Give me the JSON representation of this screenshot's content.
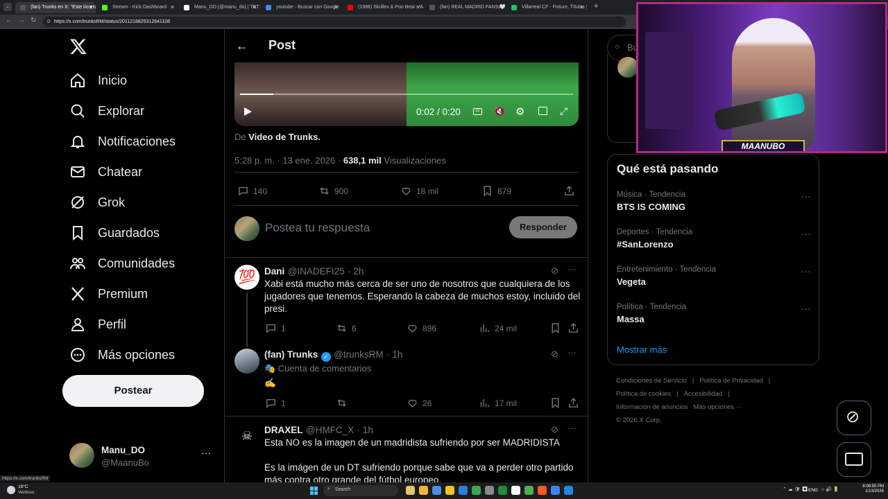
{
  "browser": {
    "tabs": [
      {
        "label": "(fan) Trunks en X: \"Este tío era...",
        "color": "#555"
      },
      {
        "label": "Stream - Kick Dashboard",
        "color": "#53fc18"
      },
      {
        "label": "Manu_DO (@manu_do) | TikT...",
        "color": "#fff"
      },
      {
        "label": "youtube - Buscar con Google",
        "color": "#4285f4"
      },
      {
        "label": "(1988) Skrillex & Poo Bear - Wh...",
        "color": "#ff0000"
      },
      {
        "label": "(fan) REAL MADRID FANS 🤍 | ...",
        "color": "#555"
      },
      {
        "label": "Villarreal CF - Fixture, Títulos y...",
        "color": "#22c55e"
      }
    ],
    "url": "https://x.com/trunksRM/status/2011218825312641108",
    "status_url": "https://x.com/trunksRM"
  },
  "nav": {
    "items": [
      {
        "label": "Inicio",
        "icon": "home-icon"
      },
      {
        "label": "Explorar",
        "icon": "search-icon"
      },
      {
        "label": "Notificaciones",
        "icon": "bell-icon"
      },
      {
        "label": "Chatear",
        "icon": "mail-icon"
      },
      {
        "label": "Grok",
        "icon": "grok-icon"
      },
      {
        "label": "Guardados",
        "icon": "bookmark-icon"
      },
      {
        "label": "Comunidades",
        "icon": "communities-icon"
      },
      {
        "label": "Premium",
        "icon": "x-logo-icon"
      },
      {
        "label": "Perfil",
        "icon": "person-icon"
      },
      {
        "label": "Más opciones",
        "icon": "more-circle-icon"
      }
    ],
    "post_button": "Postear",
    "account": {
      "name": "Manu_DO",
      "handle": "@MaanuBo"
    }
  },
  "post": {
    "header": "Post",
    "video": {
      "time": "0:02 / 0:20",
      "progress": 0.1
    },
    "from_prefix": "De",
    "from_source": "Video de Trunks.",
    "timestamp": "5:28 p. m. · 13 ene. 2026 ·",
    "views": "638,1 mil",
    "views_label": "Visualizaciones",
    "stats": {
      "replies": "140",
      "reposts": "900",
      "likes": "18 mil",
      "bookmarks": "879"
    },
    "reply_placeholder": "Postea tu respuesta",
    "reply_button": "Responder"
  },
  "replies": [
    {
      "name": "Dani",
      "handle": "@INADEFI25",
      "time": "· 2h",
      "text": "Xabi está mucho más cerca de ser uno de nosotros que cualquiera de los jugadores que tenemos. Esperando la cabeza de muchos estoy, incluido del presi.",
      "replies": "1",
      "reposts": "6",
      "likes": "896",
      "views": "24 mil",
      "avatar_glyph": "💯"
    },
    {
      "name": "(fan) Trunks",
      "handle": "@trunksRM",
      "time": "· 1h",
      "tag": "🎭 Cuenta de comentarios",
      "text": "✍️",
      "replies": "1",
      "reposts": "",
      "likes": "26",
      "views": "17 mil"
    },
    {
      "name": "DRAXEL",
      "handle": "@HMFC_X",
      "time": "· 1h",
      "text1": "Esta NO es la imagen de un madridista sufriendo por ser MADRIDISTA",
      "text2": "Es la imágen de un DT sufriendo porque sabe que va a perder otro partido más contra otro grande del fútbol europeo."
    }
  ],
  "sidebar": {
    "search_placeholder": "Bu",
    "trends_title": "Qué está pasando",
    "trends": [
      {
        "category": "Música · Tendencia",
        "title": "BTS IS COMING"
      },
      {
        "category": "Deportes · Tendencia",
        "title": "#SanLorenzo"
      },
      {
        "category": "Entretenimiento · Tendencia",
        "title": "Vegeta"
      },
      {
        "category": "Política · Tendencia",
        "title": "Massa"
      }
    ],
    "show_more": "Mostrar más",
    "footer": [
      "Condiciones de Servicio",
      "|",
      "Política de Privacidad",
      "|",
      "Política de cookies",
      "|",
      "Accesibilidad",
      "|",
      "Información de anuncios",
      "Más opciones ···",
      "© 2026 X Corp."
    ]
  },
  "overlay": {
    "streamer_name": "MAANUBO"
  },
  "taskbar": {
    "weather_temp": "19°C",
    "weather_desc": "Ventoso",
    "search": "Search",
    "lang": "ENG",
    "time": "8:08:55 PM",
    "date": "1/13/2026"
  },
  "colors": {
    "accent": "#1d9bf0",
    "muted": "#71767b",
    "border": "#2f3336"
  }
}
